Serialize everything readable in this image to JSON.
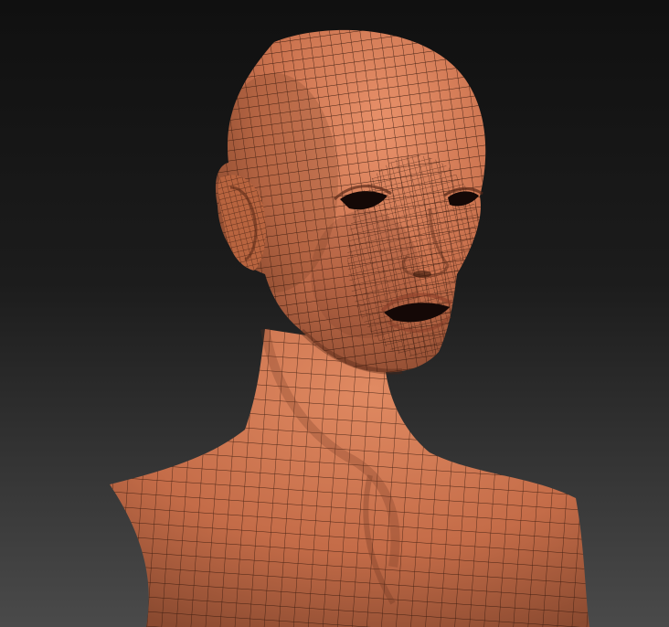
{
  "scene": {
    "subject": "wireframe-sculpt-female-bust",
    "colors": {
      "background_top": "#101010",
      "background_bottom": "#4a4a4a",
      "skin_light": "#e8916a",
      "skin_mid": "#c9714d",
      "skin_dark": "#7a3f28",
      "wire": "#2a1208",
      "cavity": "#140806"
    }
  }
}
